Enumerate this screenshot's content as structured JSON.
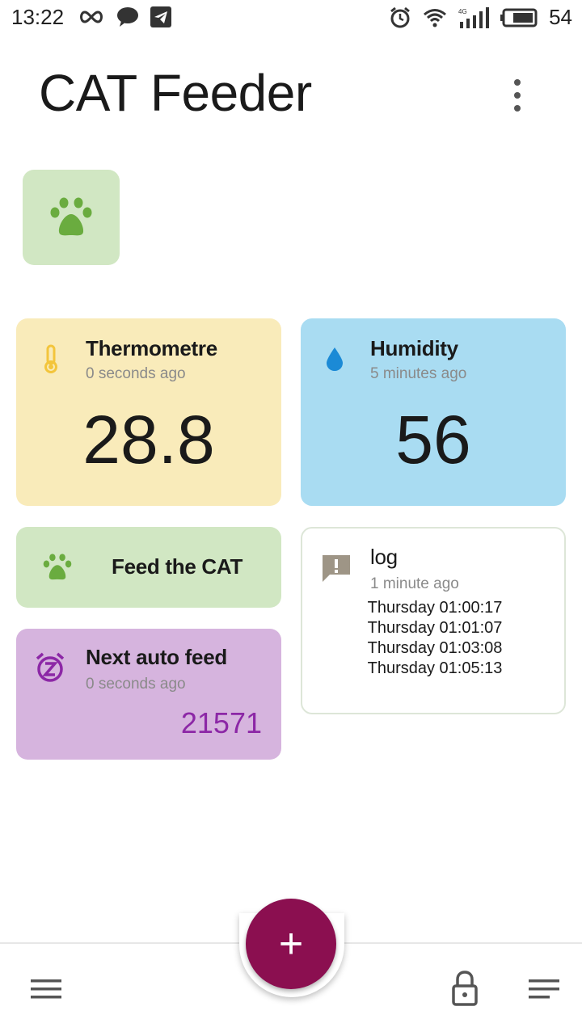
{
  "status_bar": {
    "time": "13:22",
    "battery": "54",
    "network": "4G"
  },
  "app": {
    "title": "CAT Feeder"
  },
  "cards": {
    "thermometre": {
      "title": "Thermometre",
      "subtitle": "0 seconds ago",
      "value": "28.8",
      "accent": "#f3c53c",
      "bg": "#f9ebba"
    },
    "humidity": {
      "title": "Humidity",
      "subtitle": "5 minutes ago",
      "value": "56",
      "accent": "#1b8ad6",
      "bg": "#a9dcf2"
    },
    "feed": {
      "label": "Feed the CAT",
      "accent": "#6aac3f",
      "bg": "#d1e7c3"
    },
    "log": {
      "title": "log",
      "subtitle": "1 minute ago",
      "entries": [
        "Thursday 01:00:17",
        "Thursday 01:01:07",
        "Thursday 01:03:08",
        "Thursday 01:05:13"
      ]
    },
    "auto_feed": {
      "title": "Next auto feed",
      "subtitle": "0 seconds ago",
      "value": "21571",
      "accent": "#8c27a6",
      "bg": "#d6b4de"
    }
  },
  "fab": {
    "label": "+",
    "color": "#8b0f50"
  },
  "icons": {
    "status": [
      "infinity-icon",
      "chat-bubble-icon",
      "telegram-icon",
      "alarm-icon",
      "wifi-icon",
      "signal-icon",
      "battery-icon"
    ],
    "nav": [
      "hamburger-menu-icon",
      "lock-icon",
      "list-icon"
    ]
  }
}
